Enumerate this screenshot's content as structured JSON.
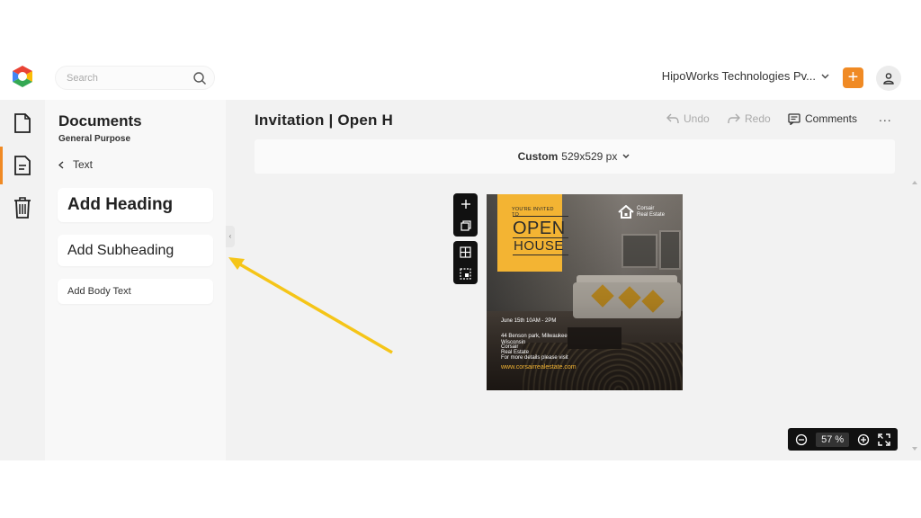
{
  "topbar": {
    "search_placeholder": "Search",
    "org_name": "HipoWorks Technologies Pv...",
    "add_label": "+"
  },
  "panel": {
    "title": "Documents",
    "subtitle": "General Purpose",
    "back_label": "Text",
    "add_heading": "Add Heading",
    "add_subheading": "Add Subheading",
    "add_body": "Add Body Text"
  },
  "main": {
    "doc_title": "Invitation | Open H",
    "undo": "Undo",
    "redo": "Redo",
    "comments": "Comments",
    "more": "...",
    "size_label": "Custom",
    "size_value": "529x529 px",
    "zoom_value": "57",
    "zoom_unit": "%"
  },
  "design": {
    "invited": "YOU'RE INVITED TO",
    "open": "OPEN",
    "house": "HOUSE",
    "brand_line1": "Corsair",
    "brand_line2": "Real Estate",
    "date": "June 15th 10AM - 2PM",
    "address1": "44 Benson park, Milwaukee",
    "address2": "Wisconsin",
    "company1": "Corsair",
    "company2": "Real Estate",
    "details": "For more details please visit",
    "website": "www.corsairrealestate.com"
  },
  "colors": {
    "accent": "#f08a24",
    "design_yellow": "#f3b433",
    "annotation_arrow": "#f5c518"
  }
}
